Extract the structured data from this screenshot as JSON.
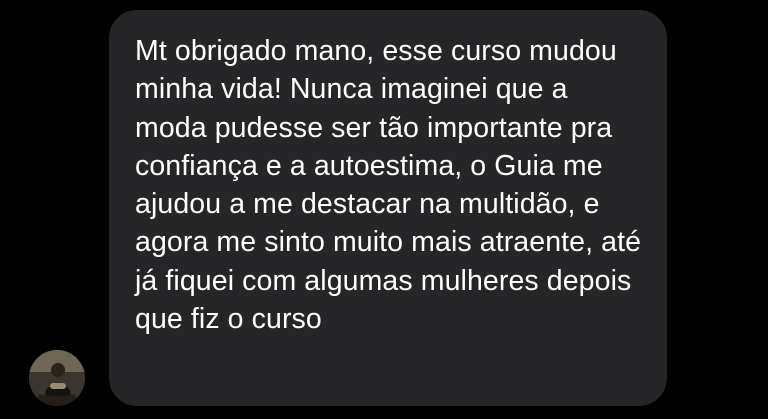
{
  "conversation": {
    "incoming_message": {
      "text": "Mt obrigado mano, esse curso mudou minha vida! Nunca imaginei que a moda pudesse ser tão importante pra confiança e a autoestima, o Guia me ajudou a me destacar na multidão, e agora me sinto muito mais atraente, até já fiquei com algumas mulheres depois que fiz o curso"
    },
    "sender": {
      "avatar_icon": "user-avatar"
    }
  },
  "colors": {
    "background": "#000000",
    "bubble": "#262628",
    "text": "#ffffff"
  }
}
